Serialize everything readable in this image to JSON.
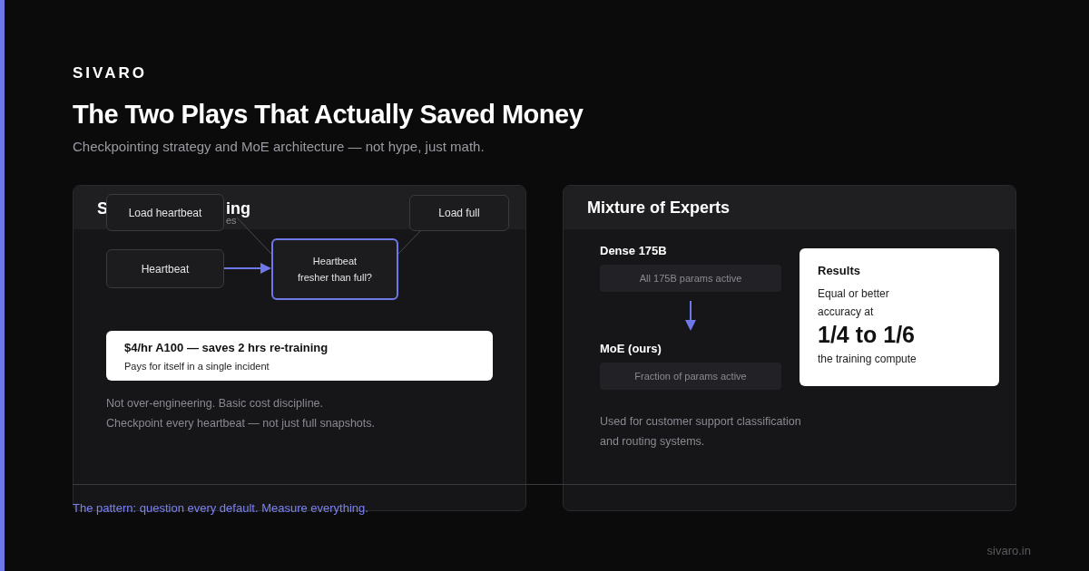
{
  "brand": "SIVARO",
  "title": "The Two Plays That Actually Saved Money",
  "subtitle": "Checkpointing strategy and MoE architecture — not hype, just math.",
  "left_card": {
    "title_start": "S",
    "title_end": "ing",
    "subtitle_fragment": "es",
    "diagram": {
      "nodes": [
        {
          "label": "Load heartbeat",
          "kind": "plain"
        },
        {
          "label": "Load full",
          "kind": "plain"
        },
        {
          "label": "Heartbeat",
          "kind": "plain"
        },
        {
          "label": "Heartbeat\nfresher than full?",
          "kind": "decision"
        }
      ]
    },
    "callout": {
      "title": "$4/hr A100 — saves 2 hrs re-training",
      "text": "Pays for itself in a single incident"
    },
    "notes": [
      "Not over-engineering. Basic cost discipline.",
      "Checkpoint every heartbeat — not just full snapshots."
    ]
  },
  "right_card": {
    "title": "Mixture of Experts",
    "models": [
      {
        "name": "Dense 175B",
        "detail": "All 175B params active"
      },
      {
        "name": "MoE (ours)",
        "detail": "Fraction of params active"
      }
    ],
    "results": {
      "title": "Results",
      "lines": [
        "Equal or better",
        "accuracy at"
      ],
      "highlight": "1/4 to 1/6",
      "caption": "the training compute"
    },
    "note": [
      "Used for customer support classification",
      "and routing systems."
    ]
  },
  "footer": "The pattern: question every default. Measure everything.",
  "site": "sivaro.in"
}
